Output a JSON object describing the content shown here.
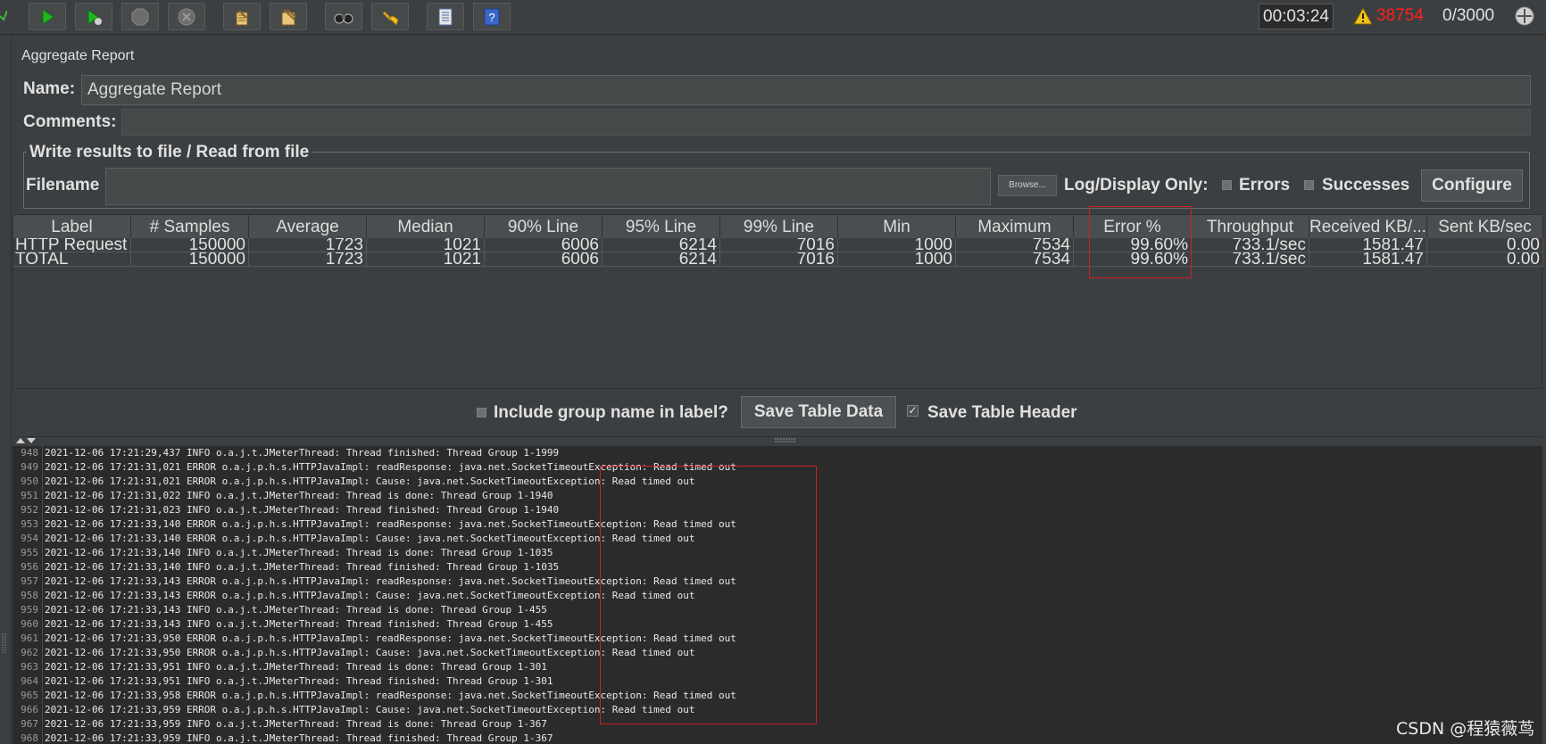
{
  "toolbar": {
    "buttons": [
      "check-icon",
      "start-icon",
      "start-no-pauses-icon",
      "stop-icon",
      "shutdown-icon",
      "clear-icon",
      "clear-all-icon",
      "search-icon",
      "reset-search-icon",
      "function-helper-icon",
      "help-icon"
    ],
    "timer": "00:03:24",
    "error_count": "38754",
    "threads": "0/3000"
  },
  "panel": {
    "title": "Aggregate Report",
    "name_label": "Name:",
    "name_value": "Aggregate Report",
    "comments_label": "Comments:",
    "file_legend": "Write results to file / Read from file",
    "filename_label": "Filename",
    "browse_label": "Browse...",
    "log_display_label": "Log/Display Only:",
    "errors_label": "Errors",
    "successes_label": "Successes",
    "configure_label": "Configure"
  },
  "table": {
    "headers": [
      "Label",
      "# Samples",
      "Average",
      "Median",
      "90% Line",
      "95% Line",
      "99% Line",
      "Min",
      "Maximum",
      "Error %",
      "Throughput",
      "Received KB/...",
      "Sent KB/sec"
    ],
    "rows": [
      [
        "HTTP Request",
        "150000",
        "1723",
        "1021",
        "6006",
        "6214",
        "7016",
        "1000",
        "7534",
        "99.60%",
        "733.1/sec",
        "1581.47",
        "0.00"
      ],
      [
        "TOTAL",
        "150000",
        "1723",
        "1021",
        "6006",
        "6214",
        "7016",
        "1000",
        "7534",
        "99.60%",
        "733.1/sec",
        "1581.47",
        "0.00"
      ]
    ]
  },
  "controls": {
    "include_group_label": "Include group name in label?",
    "save_table_data": "Save Table Data",
    "save_table_header": "Save Table Header"
  },
  "log": [
    {
      "n": "948",
      "t": "2021-12-06 17:21:29,437 INFO o.a.j.t.JMeterThread: Thread finished: Thread Group 1-1999"
    },
    {
      "n": "949",
      "t": "2021-12-06 17:21:31,021 ERROR o.a.j.p.h.s.HTTPJavaImpl: readResponse: java.net.SocketTimeoutException: Read timed out"
    },
    {
      "n": "950",
      "t": "2021-12-06 17:21:31,021 ERROR o.a.j.p.h.s.HTTPJavaImpl: Cause: java.net.SocketTimeoutException: Read timed out"
    },
    {
      "n": "951",
      "t": "2021-12-06 17:21:31,022 INFO o.a.j.t.JMeterThread: Thread is done: Thread Group 1-1940"
    },
    {
      "n": "952",
      "t": "2021-12-06 17:21:31,023 INFO o.a.j.t.JMeterThread: Thread finished: Thread Group 1-1940"
    },
    {
      "n": "953",
      "t": "2021-12-06 17:21:33,140 ERROR o.a.j.p.h.s.HTTPJavaImpl: readResponse: java.net.SocketTimeoutException: Read timed out"
    },
    {
      "n": "954",
      "t": "2021-12-06 17:21:33,140 ERROR o.a.j.p.h.s.HTTPJavaImpl: Cause: java.net.SocketTimeoutException: Read timed out"
    },
    {
      "n": "955",
      "t": "2021-12-06 17:21:33,140 INFO o.a.j.t.JMeterThread: Thread is done: Thread Group 1-1035"
    },
    {
      "n": "956",
      "t": "2021-12-06 17:21:33,140 INFO o.a.j.t.JMeterThread: Thread finished: Thread Group 1-1035"
    },
    {
      "n": "957",
      "t": "2021-12-06 17:21:33,143 ERROR o.a.j.p.h.s.HTTPJavaImpl: readResponse: java.net.SocketTimeoutException: Read timed out"
    },
    {
      "n": "958",
      "t": "2021-12-06 17:21:33,143 ERROR o.a.j.p.h.s.HTTPJavaImpl: Cause: java.net.SocketTimeoutException: Read timed out"
    },
    {
      "n": "959",
      "t": "2021-12-06 17:21:33,143 INFO o.a.j.t.JMeterThread: Thread is done: Thread Group 1-455"
    },
    {
      "n": "960",
      "t": "2021-12-06 17:21:33,143 INFO o.a.j.t.JMeterThread: Thread finished: Thread Group 1-455"
    },
    {
      "n": "961",
      "t": "2021-12-06 17:21:33,950 ERROR o.a.j.p.h.s.HTTPJavaImpl: readResponse: java.net.SocketTimeoutException: Read timed out"
    },
    {
      "n": "962",
      "t": "2021-12-06 17:21:33,950 ERROR o.a.j.p.h.s.HTTPJavaImpl: Cause: java.net.SocketTimeoutException: Read timed out"
    },
    {
      "n": "963",
      "t": "2021-12-06 17:21:33,951 INFO o.a.j.t.JMeterThread: Thread is done: Thread Group 1-301"
    },
    {
      "n": "964",
      "t": "2021-12-06 17:21:33,951 INFO o.a.j.t.JMeterThread: Thread finished: Thread Group 1-301"
    },
    {
      "n": "965",
      "t": "2021-12-06 17:21:33,958 ERROR o.a.j.p.h.s.HTTPJavaImpl: readResponse: java.net.SocketTimeoutException: Read timed out"
    },
    {
      "n": "966",
      "t": "2021-12-06 17:21:33,959 ERROR o.a.j.p.h.s.HTTPJavaImpl: Cause: java.net.SocketTimeoutException: Read timed out"
    },
    {
      "n": "967",
      "t": "2021-12-06 17:21:33,959 INFO o.a.j.t.JMeterThread: Thread is done: Thread Group 1-367"
    },
    {
      "n": "968",
      "t": "2021-12-06 17:21:33,959 INFO o.a.j.t.JMeterThread: Thread finished: Thread Group 1-367"
    }
  ],
  "watermark": "CSDN @程猿薇茑"
}
